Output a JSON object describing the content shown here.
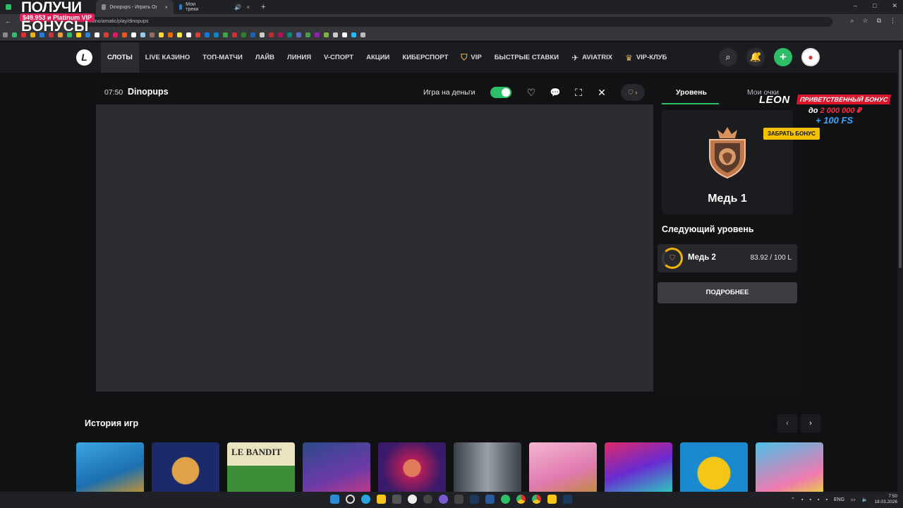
{
  "browser": {
    "tabs": [
      {
        "label": "Dinopups - Играть Онлайн | Л",
        "active": true,
        "color": "#8a8a8a"
      },
      {
        "label": "Мои треки",
        "active": false,
        "color": "#2a7bd6"
      }
    ],
    "url": "...sino/amatic/play/dinopups"
  },
  "promo": {
    "line1": "ПОЛУЧИ",
    "pill": "$49.953 и Platinum VIP",
    "line2": "БОНУСЫ"
  },
  "nav": {
    "logo": "L",
    "links": [
      {
        "label": "СЛОТЫ",
        "active": true,
        "icon": ""
      },
      {
        "label": "LIVE КАЗИНО",
        "active": false,
        "icon": ""
      },
      {
        "label": "ТОП-МАТЧИ",
        "active": false,
        "icon": ""
      },
      {
        "label": "ЛАЙВ",
        "active": false,
        "icon": ""
      },
      {
        "label": "ЛИНИЯ",
        "active": false,
        "icon": ""
      },
      {
        "label": "V-СПОРТ",
        "active": false,
        "icon": ""
      },
      {
        "label": "АКЦИИ",
        "active": false,
        "icon": ""
      },
      {
        "label": "КИБЕРСПОРТ",
        "active": false,
        "icon": ""
      },
      {
        "label": "VIP",
        "active": false,
        "icon": "shield-icon"
      },
      {
        "label": "БЫСТРЫЕ СТАВКИ",
        "active": false,
        "icon": ""
      },
      {
        "label": "AVIATRIX",
        "active": false,
        "icon": "aviatrix-icon"
      },
      {
        "label": "VIP-КЛУБ",
        "active": false,
        "icon": "crown-icon"
      }
    ]
  },
  "game": {
    "time": "07:50",
    "title": "Dinopups",
    "money_label": "Игра на деньги",
    "money_on": true
  },
  "side": {
    "tab_level": "Уровень",
    "tab_points": "Мои очки",
    "current_level": "Медь 1",
    "next_label": "Следующий уровень",
    "next_level": "Медь 2",
    "progress": "83.92 / 100 L",
    "more_button": "ПОДРОБНЕЕ"
  },
  "leon": {
    "logo": "LEON",
    "bonus": "ПРИВЕТСТВЕННЫЙ БОНУС",
    "amount_prefix": "до",
    "amount": "2 000 000 ₽",
    "fs": "+ 100 FS",
    "button": "ЗАБРАТЬ БОНУС"
  },
  "history": {
    "title": "История игр",
    "prev": "‹",
    "next": "›"
  },
  "taskbar": {
    "lang": "ENG",
    "time": "7:50",
    "date": "18.03.2026"
  },
  "colors": {
    "accent": "#2dbf68",
    "nav_bg": "#1b1c1f",
    "game_bg": "#2a2c30",
    "progress": "#f0b400"
  }
}
